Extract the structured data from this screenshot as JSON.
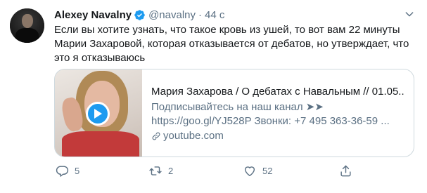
{
  "author": {
    "name": "Alexey Navalny",
    "handle": "@navalny",
    "separator": "·",
    "time": "44 с"
  },
  "tweet": {
    "text": "Если вы хотите узнать, что такое кровь из ушей, то вот вам 22 минуты Марии Захаровой, которая отказывается от дебатов, но утверждает, что это я отказываюсь"
  },
  "card": {
    "title": "Мария Захарова / О дебатах с Навальным // 01.05...",
    "description": "Подписывайтесь на наш канал ➤➤ https://goo.gl/YJ528P Звонки: +7 495 363-36-59 ...",
    "domain": "youtube.com"
  },
  "actions": {
    "replies": "5",
    "retweets": "2",
    "likes": "52"
  },
  "icons": {
    "verified": "verified-badge-icon",
    "more": "chevron-down-icon",
    "play": "play-icon",
    "link": "link-icon",
    "reply": "reply-icon",
    "retweet": "retweet-icon",
    "like": "heart-icon",
    "share": "share-icon"
  },
  "colors": {
    "accent": "#1d9bf0",
    "secondary_text": "#5b7083",
    "border": "#cfd9de"
  }
}
